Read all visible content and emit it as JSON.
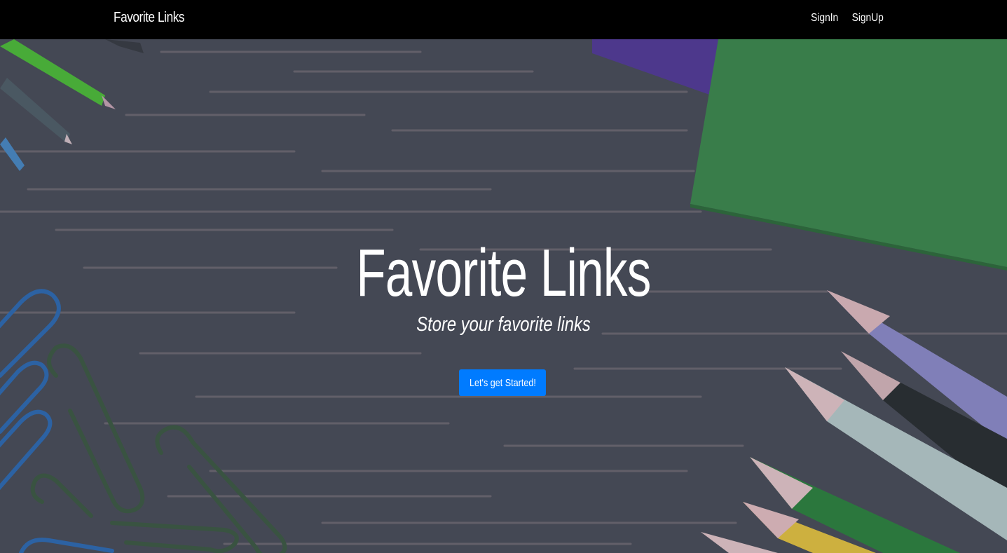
{
  "navbar": {
    "brand": "Favorite Links",
    "links": [
      {
        "label": "SignIn"
      },
      {
        "label": "SignUp"
      }
    ]
  },
  "hero": {
    "title": "Favorite Links",
    "subtitle": "Store your favorite links",
    "cta_label": "Let's get Started!"
  },
  "colors": {
    "navbar_bg": "#000000",
    "cta_bg": "#007bff",
    "board": "#4b4e5a"
  }
}
